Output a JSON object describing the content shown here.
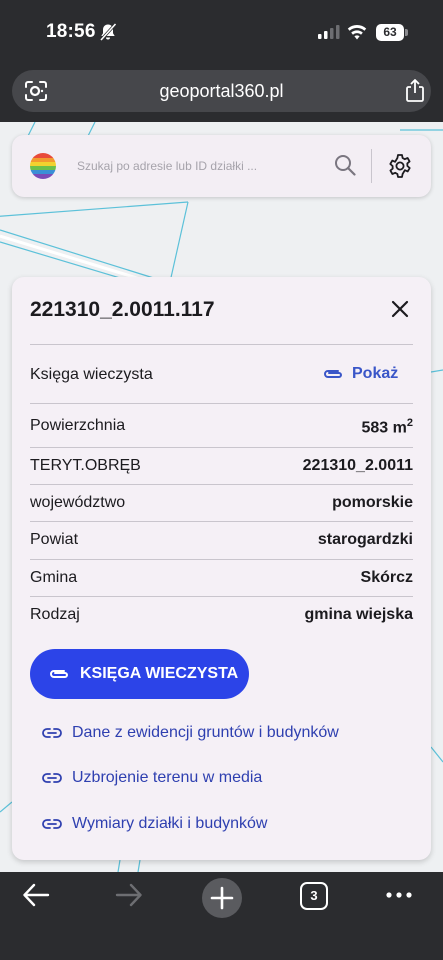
{
  "status_bar": {
    "time": "18:56",
    "battery": "63"
  },
  "browser": {
    "url": "geoportal360.pl",
    "tab_count": "3"
  },
  "search": {
    "placeholder": "Szukaj po adresie lub ID działki ..."
  },
  "parcel": {
    "id": "221310_2.0011.117",
    "land_register_label": "Księga wieczysta",
    "land_register_action": "Pokaż",
    "rows": [
      {
        "label": "Powierzchnia",
        "value": "583 m",
        "sup": "2"
      },
      {
        "label": "TERYT.OBRĘB",
        "value": "221310_2.0011"
      },
      {
        "label": "województwo",
        "value": "pomorskie"
      },
      {
        "label": "Powiat",
        "value": "starogardzki"
      },
      {
        "label": "Gmina",
        "value": "Skórcz"
      },
      {
        "label": "Rodzaj",
        "value": "gmina wiejska"
      }
    ],
    "primary_button": "KSIĘGA WIECZYSTA",
    "links": [
      "Dane z ewidencji gruntów i budynków",
      "Uzbrojenie terenu w media",
      "Wymiary działki i budynków"
    ]
  },
  "colors": {
    "accent": "#2c44e8",
    "link": "#2f40b0",
    "panel_bg": "#f5f0f6",
    "chrome_bg": "#2b2c2f"
  },
  "icons": [
    "bell-muted-icon",
    "signal-icon",
    "wifi-icon",
    "battery-icon",
    "lens-icon",
    "share-icon",
    "search-icon",
    "gear-icon",
    "close-icon",
    "paperclip-icon",
    "link-icon",
    "back-arrow-icon",
    "forward-arrow-icon",
    "plus-icon",
    "more-icon"
  ]
}
